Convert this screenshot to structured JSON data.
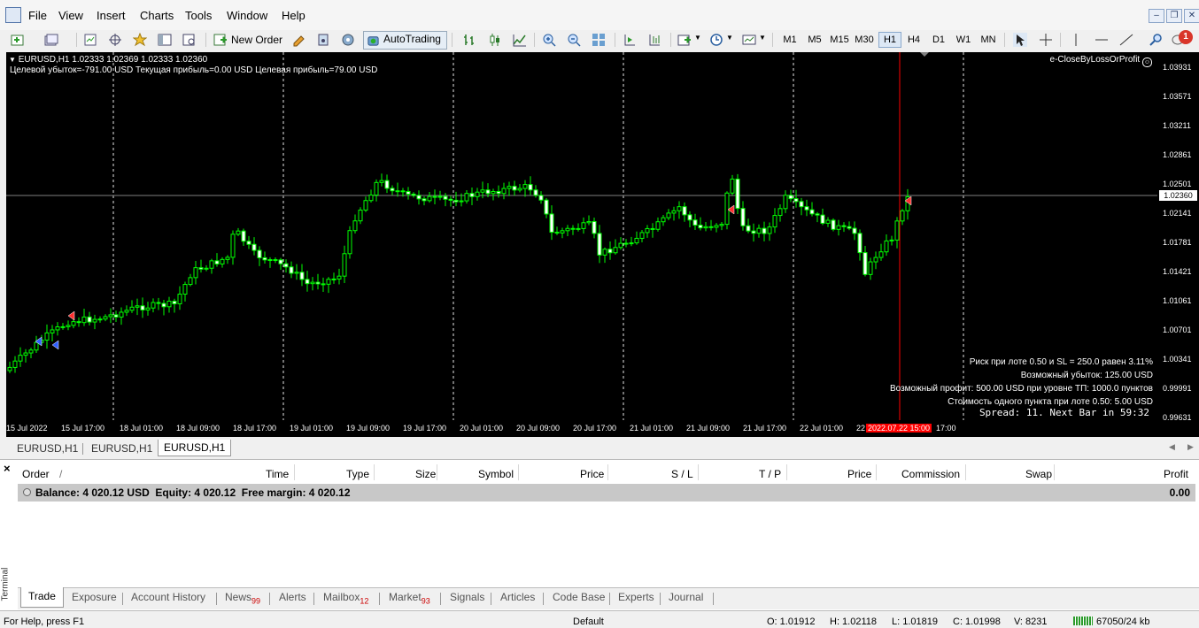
{
  "menu": [
    "File",
    "View",
    "Insert",
    "Charts",
    "Tools",
    "Window",
    "Help"
  ],
  "toolbar": {
    "new_order": "New Order",
    "autotrading": "AutoTrading",
    "timeframes": [
      "M1",
      "M5",
      "M15",
      "M30",
      "H1",
      "H4",
      "D1",
      "W1",
      "MN"
    ],
    "active_timeframe": "H1",
    "notification_count": "1"
  },
  "chart": {
    "header": "EURUSD,H1  1.02333 1.02369 1.02333 1.02360",
    "indicator_line": "Целевой убыток=-791.00 USD  Текущая прибыль=0.00 USD  Целевая прибыль=79.00 USD",
    "ea_name": "e-CloseByLossOrProfit",
    "info_lines": [
      "Риск при лоте 0.50 и SL = 250.0 равен 3.11%",
      "Возможный убыток: 125.00 USD",
      "Возможный профит: 500.00 USD при уровне ТП: 1000.0 пунктов",
      "Стоимость одного пункта при лоте 0.50: 5.00 USD"
    ],
    "spread_line": "Spread: 11. Next Bar in 59:32",
    "current_price": "1.02360",
    "price_levels": [
      "1.03931",
      "1.03571",
      "1.03211",
      "1.02861",
      "1.02501",
      "1.02141",
      "1.01781",
      "1.01421",
      "1.01061",
      "1.00701",
      "1.00341",
      "0.99991",
      "0.99631"
    ],
    "time_labels": [
      "15 Jul 2022",
      "15 Jul 17:00",
      "18 Jul 01:00",
      "18 Jul 09:00",
      "18 Jul 17:00",
      "19 Jul 01:00",
      "19 Jul 09:00",
      "19 Jul 17:00",
      "20 Jul 01:00",
      "20 Jul 09:00",
      "20 Jul 17:00",
      "21 Jul 01:00",
      "21 Jul 09:00",
      "21 Jul 17:00",
      "22 Jul 01:00",
      "22",
      "2022.07.22 15:00",
      "17:00"
    ],
    "colors": {
      "background": "#000000",
      "candle": "#00ff00",
      "bull_body": "#000000",
      "bear_body": "#ffffff",
      "grid": "#ffffff",
      "bid_line": "#808080",
      "period_line": "#ff0000",
      "text": "#ffffff"
    }
  },
  "chart_tabs": [
    "EURUSD,H1",
    "EURUSD,H1",
    "EURUSD,H1"
  ],
  "active_chart_tab": 2,
  "terminal": {
    "side_label": "Terminal",
    "columns": [
      "Order",
      "/",
      "Time",
      "Type",
      "Size",
      "Symbol",
      "Price",
      "S / L",
      "T / P",
      "Price",
      "Commission",
      "Swap",
      "Profit"
    ],
    "balance_row": "Balance: 4 020.12 USD  Equity: 4 020.12  Free margin: 4 020.12",
    "balance_profit": "0.00",
    "tabs": [
      {
        "label": "Trade",
        "badge": ""
      },
      {
        "label": "Exposure",
        "badge": ""
      },
      {
        "label": "Account History",
        "badge": ""
      },
      {
        "label": "News",
        "badge": "99"
      },
      {
        "label": "Alerts",
        "badge": ""
      },
      {
        "label": "Mailbox",
        "badge": "12"
      },
      {
        "label": "Market",
        "badge": "93"
      },
      {
        "label": "Signals",
        "badge": ""
      },
      {
        "label": "Articles",
        "badge": ""
      },
      {
        "label": "Code Base",
        "badge": ""
      },
      {
        "label": "Experts",
        "badge": ""
      },
      {
        "label": "Journal",
        "badge": ""
      }
    ]
  },
  "status": {
    "help": "For Help, press F1",
    "profile": "Default",
    "open": "O: 1.01912",
    "high": "H: 1.02118",
    "low": "L: 1.01819",
    "close": "C: 1.01998",
    "volume": "V: 8231",
    "traffic": "67050/24 kb"
  }
}
